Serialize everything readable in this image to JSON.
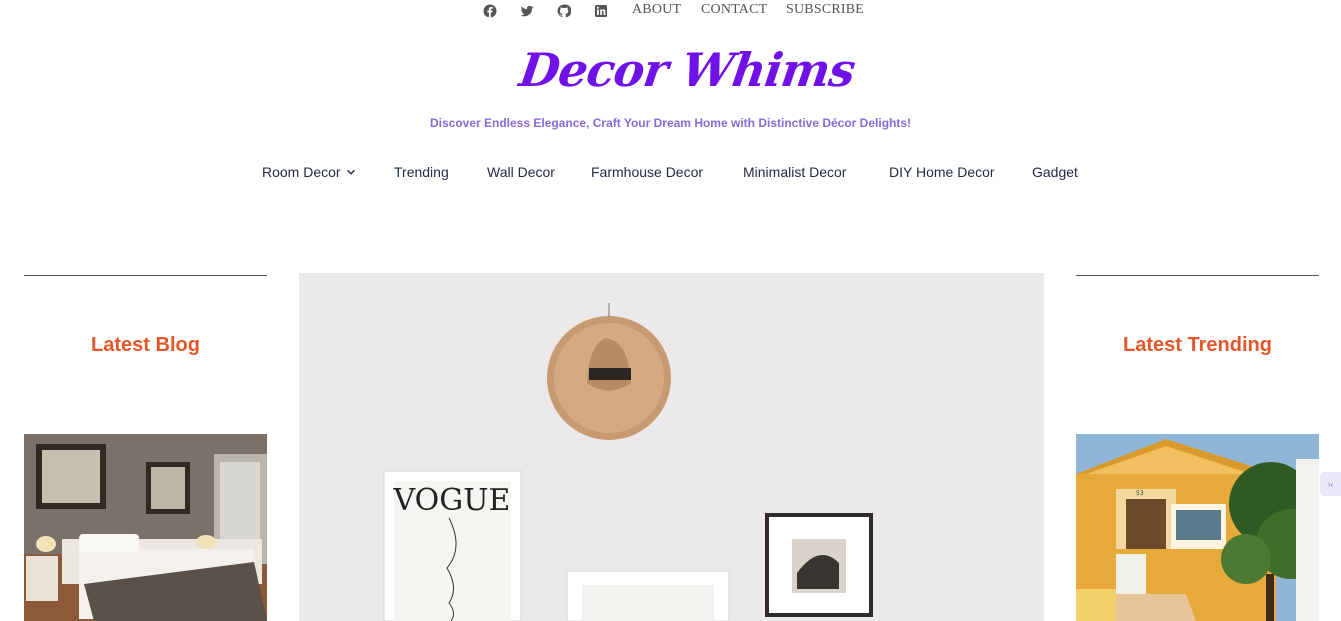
{
  "topbar": {
    "social_icons": [
      "facebook-icon",
      "twitter-icon",
      "github-icon",
      "linkedin-icon"
    ],
    "links": [
      "ABOUT",
      "CONTACT",
      "SUBSCRIBE"
    ]
  },
  "site": {
    "logo_text": "Decor Whims",
    "tagline": "Discover Endless Elegance, Craft Your Dream Home with Distinctive Décor Delights!"
  },
  "nav": {
    "items": [
      "Room Decor",
      "Trending",
      "Wall Decor",
      "Farmhouse Decor",
      "Minimalist Decor",
      "DIY Home Decor",
      "Gadget"
    ]
  },
  "left_column": {
    "title": "Latest Blog"
  },
  "right_column": {
    "title": "Latest Trending"
  },
  "hero": {
    "poster_text": "VOGUE"
  },
  "house": {
    "number": "53"
  },
  "colors": {
    "logo": "#7011e8",
    "tagline": "#8a6ad6",
    "section_title": "#e5572b",
    "nav_text": "#1f2a44"
  }
}
